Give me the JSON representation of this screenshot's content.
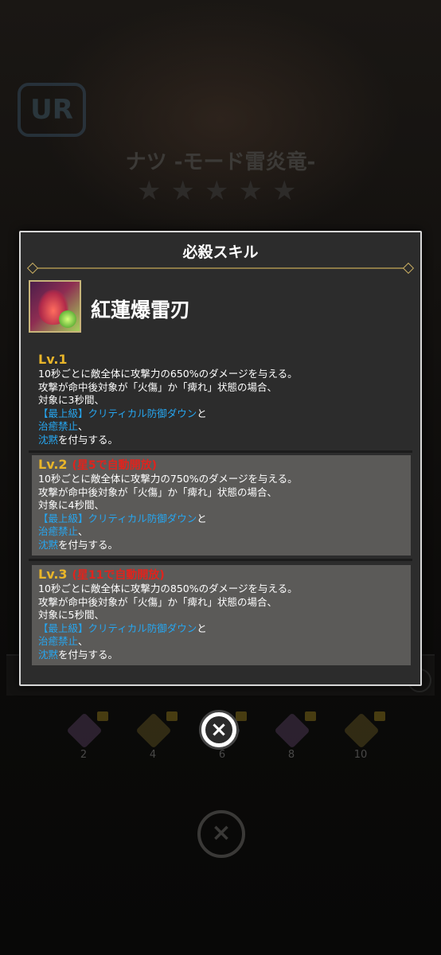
{
  "background": {
    "rarity": "UR",
    "character_name": "ナツ -モード雷炎竜-",
    "stars": [
      "★",
      "★",
      "★",
      "★",
      "★"
    ],
    "awaken_slots": [
      {
        "count": "2",
        "color": "#6b4c77"
      },
      {
        "count": "4",
        "color": "#7a6a2a"
      },
      {
        "count": "6",
        "color": "#5a6d8a"
      },
      {
        "count": "8",
        "color": "#6b4c77"
      },
      {
        "count": "10",
        "color": "#7a6a2a"
      }
    ]
  },
  "modal": {
    "title": "必殺スキル",
    "skill_name": "紅蓮爆雷刃",
    "levels": [
      {
        "label": "Lv.1",
        "unlock": "",
        "line1": "10秒ごとに敵全体に攻撃力の650%のダメージを与える。",
        "line2": "攻撃が命中後対象が「火傷」か「痺れ」状態の場合、",
        "line3": "対象に3秒間、",
        "blue1": "【最上級】クリティカル防御ダウン",
        "and": "と",
        "blue2": "治癒禁止",
        "comma": "、",
        "blue3": "沈黙",
        "tail": "を付与する。"
      },
      {
        "label": "Lv.2",
        "unlock": "(星5で自動開放)",
        "line1": "10秒ごとに敵全体に攻撃力の750%のダメージを与える。",
        "line2": "攻撃が命中後対象が「火傷」か「痺れ」状態の場合、",
        "line3": "対象に4秒間、",
        "blue1": "【最上級】クリティカル防御ダウン",
        "and": "と",
        "blue2": "治癒禁止",
        "comma": "、",
        "blue3": "沈黙",
        "tail": "を付与する。"
      },
      {
        "label": "Lv.3",
        "unlock": "(星11で自動開放)",
        "line1": "10秒ごとに敵全体に攻撃力の850%のダメージを与える。",
        "line2": "攻撃が命中後対象が「火傷」か「痺れ」状態の場合、",
        "line3": "対象に5秒間、",
        "blue1": "【最上級】クリティカル防御ダウン",
        "and": "と",
        "blue2": "治癒禁止",
        "comma": "、",
        "blue3": "沈黙",
        "tail": "を付与する。"
      }
    ]
  },
  "close_icon": "×"
}
